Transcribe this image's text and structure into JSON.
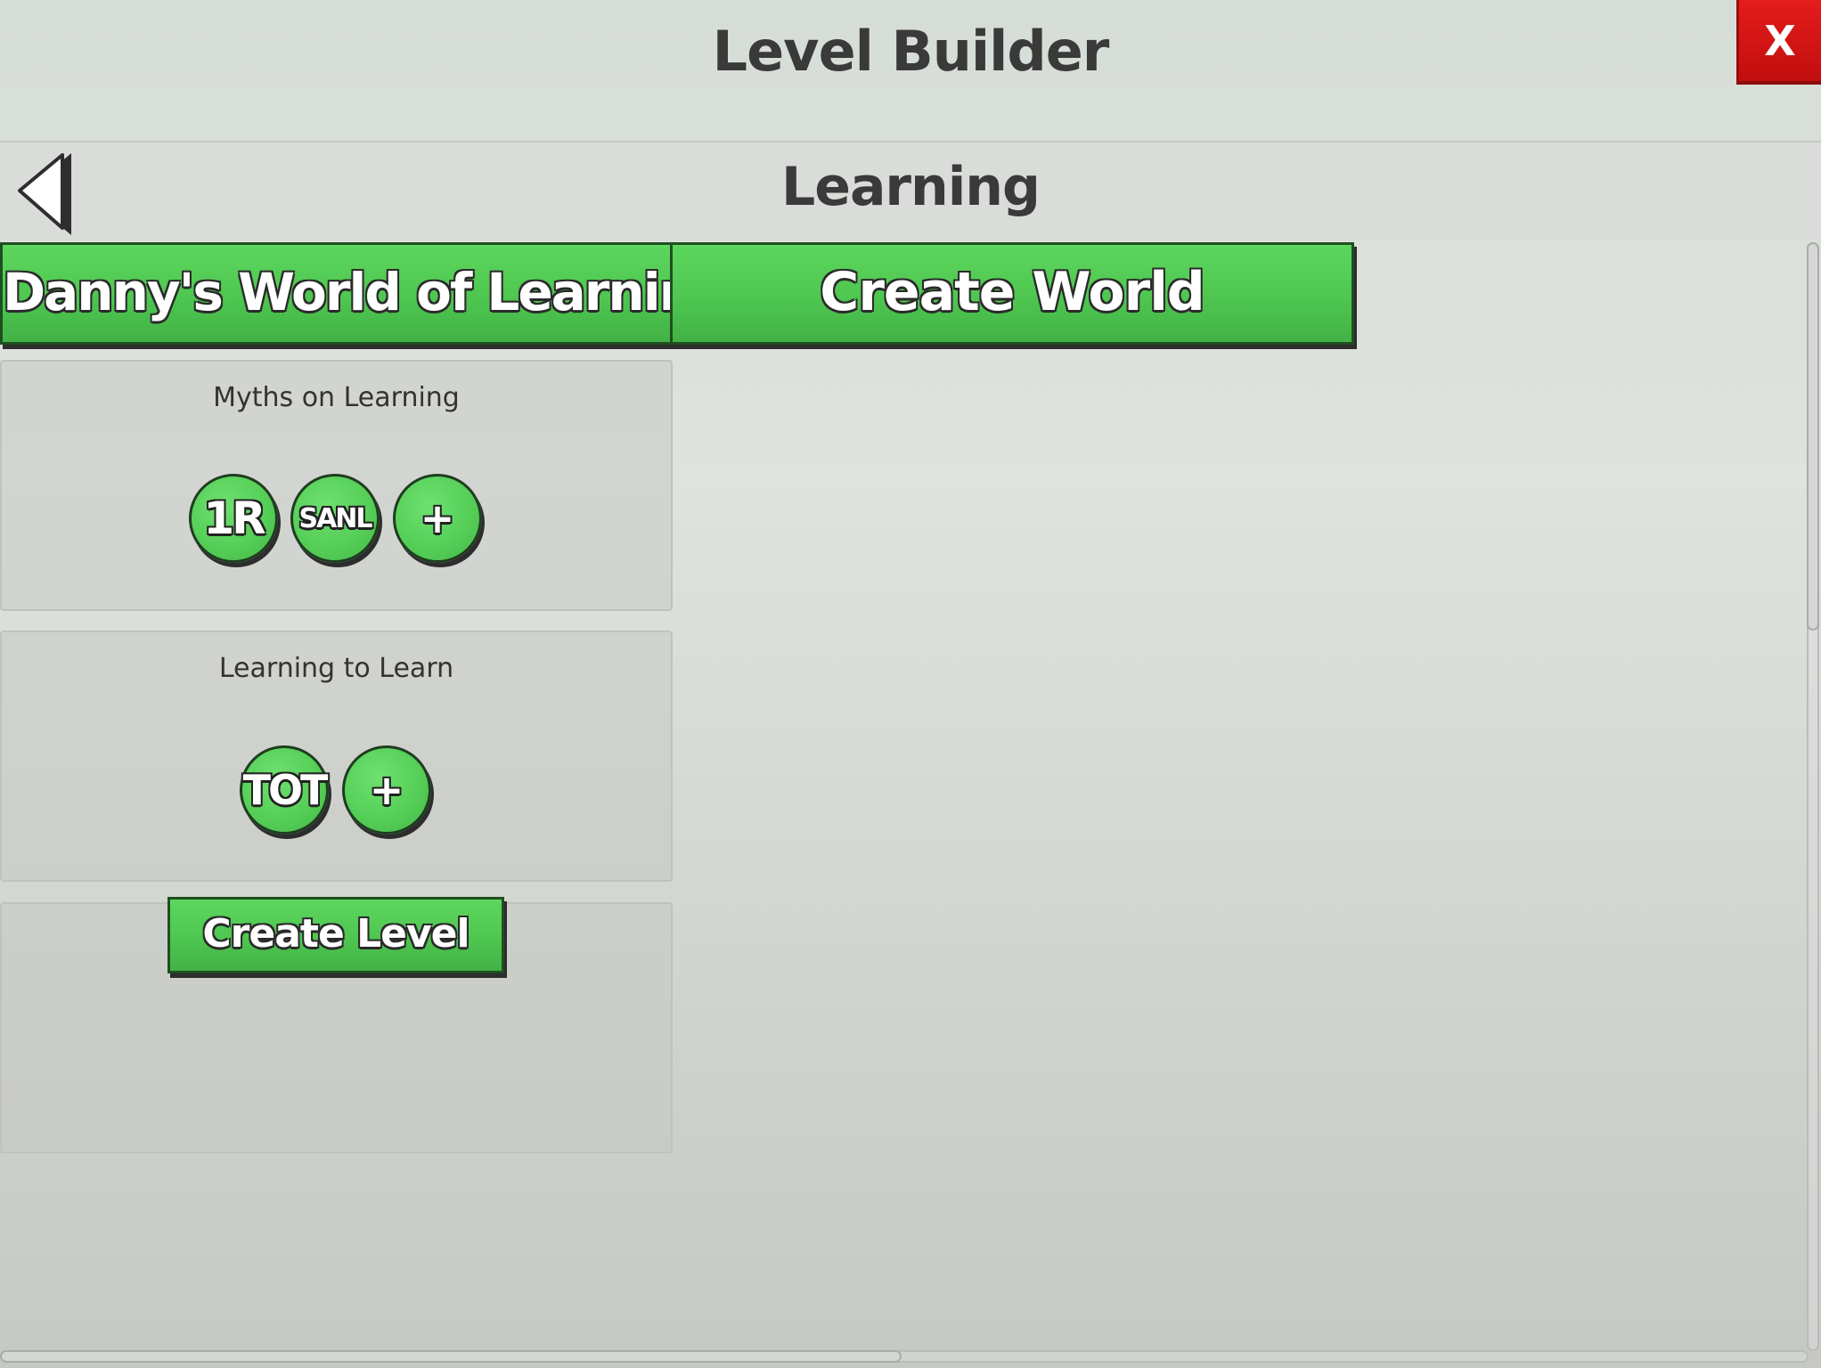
{
  "app": {
    "title": "Level Builder",
    "close_label": "X"
  },
  "header": {
    "section_title": "Learning",
    "back_icon": "chevron-left-icon"
  },
  "world_bar": {
    "world_tab_label": "Danny's World of Learning",
    "create_world_label": "Create World"
  },
  "panels": [
    {
      "title": "Myths on Learning",
      "levels": [
        "1R",
        "SANL"
      ],
      "add_label": "+"
    },
    {
      "title": "Learning to Learn",
      "levels": [
        "TOT"
      ],
      "add_label": "+"
    }
  ],
  "create_level_label": "Create Level",
  "colors": {
    "accent_green": "#4ec650",
    "close_red": "#d41616",
    "title_text": "#3a3a3a"
  }
}
